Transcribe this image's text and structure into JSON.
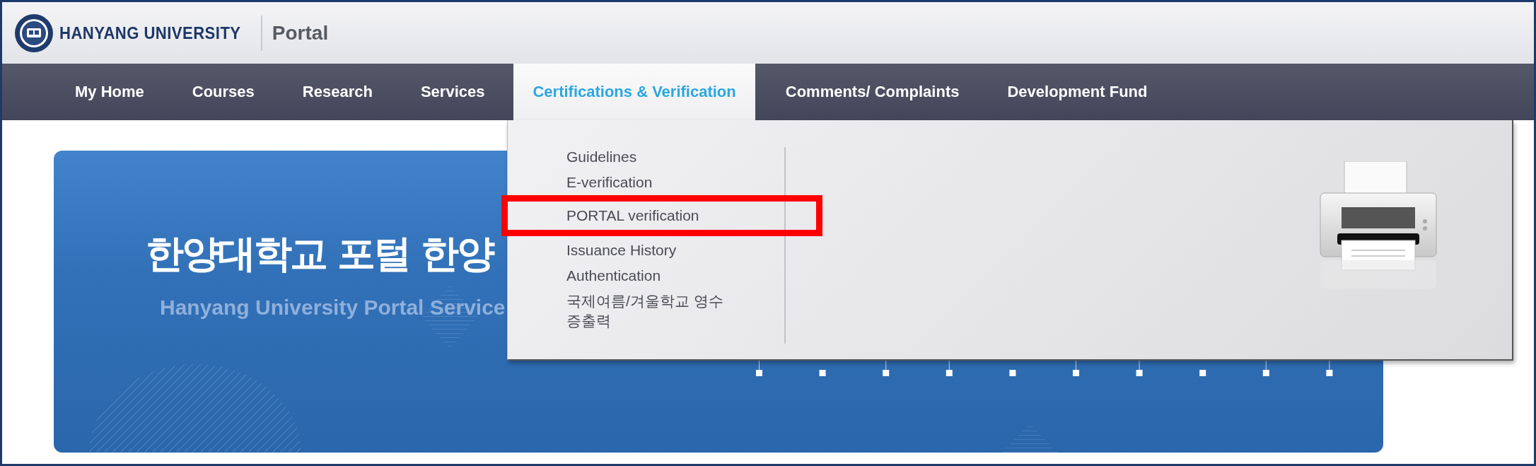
{
  "header": {
    "logo_text": "HANYANG UNIVERSITY",
    "title": "Portal"
  },
  "nav": [
    {
      "label": "My Home",
      "selected": false
    },
    {
      "label": "Courses",
      "selected": false
    },
    {
      "label": "Research",
      "selected": false
    },
    {
      "label": "Services",
      "selected": false
    },
    {
      "label": "Certifications & Verification",
      "selected": true
    },
    {
      "label": "Comments/ Complaints",
      "selected": false
    },
    {
      "label": "Development Fund",
      "selected": false
    }
  ],
  "dropdown": {
    "items": [
      {
        "label": "Guidelines",
        "highlighted": false
      },
      {
        "label": "E-verification",
        "highlighted": false
      },
      {
        "label": "PORTAL verification",
        "highlighted": true
      },
      {
        "label": "Issuance History",
        "highlighted": false
      },
      {
        "label": "Authentication",
        "highlighted": false
      },
      {
        "label": "국제여름/겨울학교 영수증출력",
        "highlighted": false
      }
    ]
  },
  "banner": {
    "title": "한양대학교 포털 한양",
    "subtitle": "Hanyang University Portal Service"
  }
}
